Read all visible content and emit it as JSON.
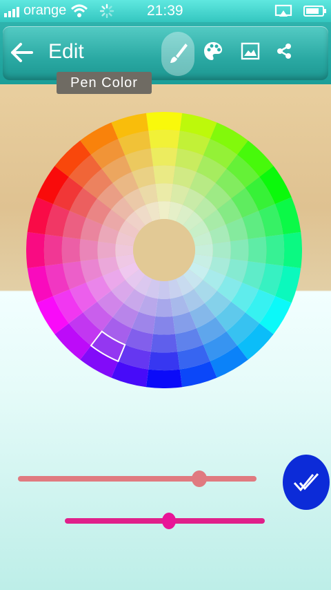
{
  "status_bar": {
    "carrier": "orange",
    "time": "21:39"
  },
  "toolbar": {
    "title": "Edit",
    "back_icon": "arrow-left-icon",
    "tools": [
      {
        "name": "pen-tool",
        "icon": "brush-icon",
        "active": true
      },
      {
        "name": "palette-tool",
        "icon": "palette-icon",
        "active": false
      },
      {
        "name": "image-tool",
        "icon": "image-icon",
        "active": false
      },
      {
        "name": "share-tool",
        "icon": "share-icon",
        "active": false
      }
    ]
  },
  "tooltip": {
    "label": "Pen Color"
  },
  "color_wheel": {
    "rings": 6,
    "segments": 24,
    "selected_segment": 14,
    "selected_ring": 4
  },
  "sliders": [
    {
      "name": "size-slider",
      "value": 0.76,
      "track_color": "#e07a80",
      "thumb_color": "#e07a80"
    },
    {
      "name": "opacity-slider",
      "value": 0.52,
      "track_color": "#e0208a",
      "thumb_color": "#e81597"
    }
  ],
  "colors": {
    "accent": "#27b1aa",
    "confirm": "#0c2bd8"
  }
}
